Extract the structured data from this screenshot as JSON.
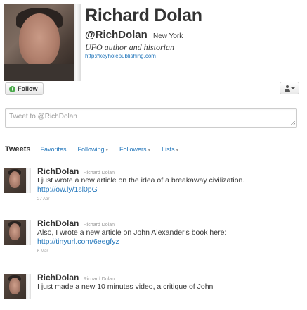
{
  "profile": {
    "name": "Richard Dolan",
    "handle": "@RichDolan",
    "location": "New York",
    "bio": "UFO author and historian",
    "url": "http://keyholepublishing.com"
  },
  "actions": {
    "follow_label": "Follow"
  },
  "compose": {
    "placeholder": "Tweet to @RichDolan"
  },
  "tabs": [
    {
      "label": "Tweets",
      "active": true
    },
    {
      "label": "Favorites"
    },
    {
      "label": "Following"
    },
    {
      "label": "Followers"
    },
    {
      "label": "Lists"
    }
  ],
  "tweets": [
    {
      "author": "RichDolan",
      "author_sub": "Richard Dolan",
      "text": "I just wrote a new article on the idea of a breakaway civilization.",
      "link": "http://ow.ly/1sl0pG",
      "date": "27 Apr"
    },
    {
      "author": "RichDolan",
      "author_sub": "Richard Dolan",
      "text": "Also, I wrote a new article on John Alexander's book here:",
      "link": "http://tinyurl.com/6eegfyz",
      "date": "6 Mar"
    },
    {
      "author": "RichDolan",
      "author_sub": "Richard Dolan",
      "text": "I just made a new 10 minutes video, a critique of John"
    }
  ],
  "colors": {
    "link": "#2276bb",
    "text": "#333333",
    "muted": "#999999",
    "follow_icon": "#4aa84a"
  }
}
